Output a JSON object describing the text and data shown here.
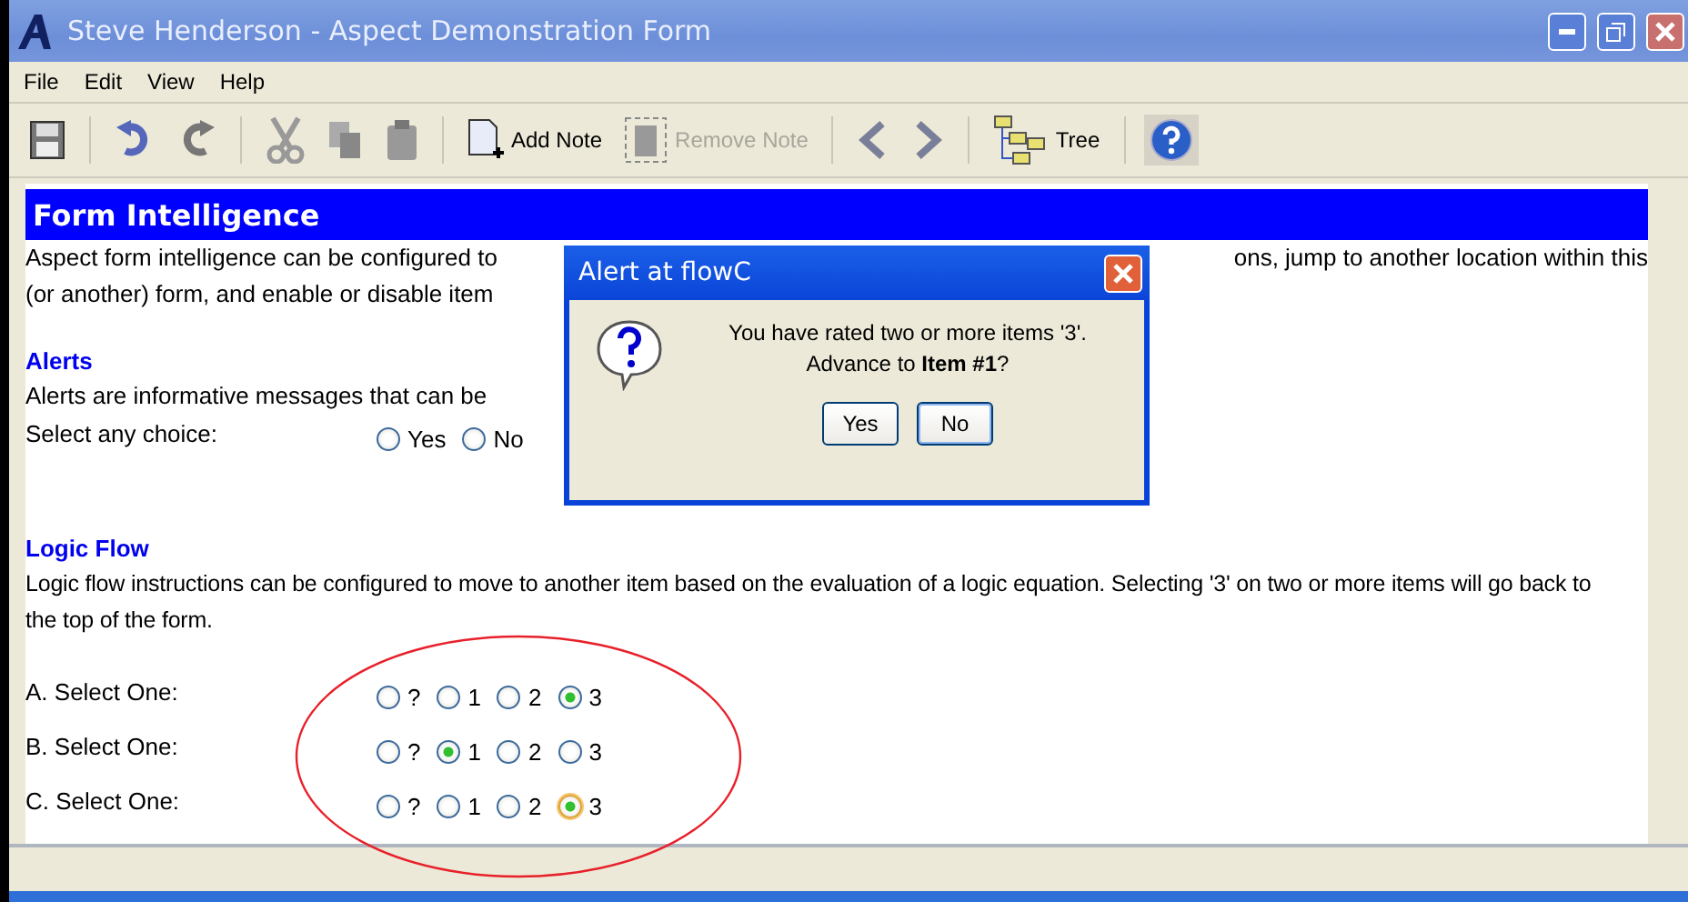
{
  "window": {
    "title": "Steve Henderson - Aspect Demonstration Form"
  },
  "menu": [
    "File",
    "Edit",
    "View",
    "Help"
  ],
  "toolbar": {
    "note_buttons": [
      {
        "label": "Add Note",
        "disabled": false
      },
      {
        "label": "Remove Note",
        "disabled": true
      }
    ],
    "tree_button": {
      "label": "Tree"
    }
  },
  "form": {
    "header": "Form Intelligence",
    "intro_line_1": "Aspect form intelligence can be configured to",
    "intro_line_1_end": "ons, jump to another location within this",
    "intro_line_2": "(or another) form, and enable or disable item",
    "alerts": {
      "heading": "Alerts",
      "text": "Alerts are informative messages that can be",
      "prompt": "Select any choice:",
      "options": [
        {
          "label": "Yes",
          "selected": false
        },
        {
          "label": "No",
          "selected": false
        }
      ]
    },
    "logic": {
      "heading": "Logic Flow",
      "text": "Logic flow instructions can be configured to move to another item based on the evaluation of a logic equation. Selecting '3' on two or more items will go back to the top of the form.",
      "questions": [
        {
          "label": "A. Select One:",
          "focused": false,
          "options": [
            {
              "label": "?",
              "selected": false
            },
            {
              "label": "1",
              "selected": false
            },
            {
              "label": "2",
              "selected": false
            },
            {
              "label": "3",
              "selected": true
            }
          ]
        },
        {
          "label": "B. Select One:",
          "focused": false,
          "options": [
            {
              "label": "?",
              "selected": false
            },
            {
              "label": "1",
              "selected": true
            },
            {
              "label": "2",
              "selected": false
            },
            {
              "label": "3",
              "selected": false
            }
          ]
        },
        {
          "label": "C. Select One:",
          "focused": true,
          "options": [
            {
              "label": "?",
              "selected": false
            },
            {
              "label": "1",
              "selected": false
            },
            {
              "label": "2",
              "selected": false
            },
            {
              "label": "3",
              "selected": true
            }
          ]
        }
      ]
    }
  },
  "dialog": {
    "title": "Alert at flowC",
    "message": "You have rated two or more items '3'.",
    "message_2": "Advance to **Item #1**?",
    "buttons": [
      "Yes",
      "No"
    ]
  }
}
